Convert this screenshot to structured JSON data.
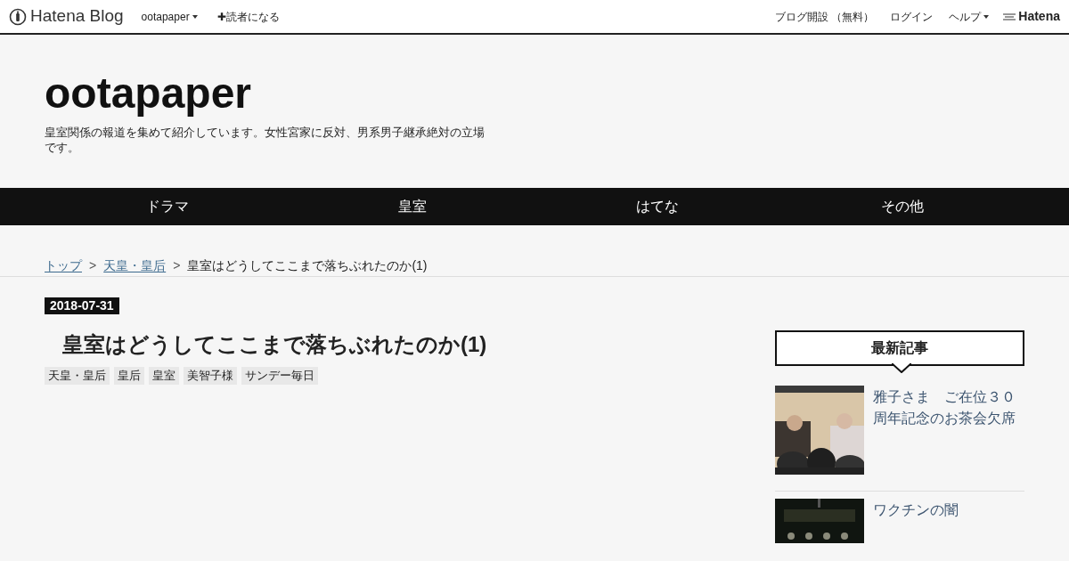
{
  "topbar": {
    "logo": "Hatena Blog",
    "blog_menu": "ootapaper",
    "subscribe": "✚読者になる",
    "links": [
      "ブログ開設 （無料）",
      "ログイン"
    ],
    "help_menu": "ヘルプ",
    "brand": "Hatena"
  },
  "blog": {
    "title": "ootapaper",
    "description": "皇室関係の報道を集めて紹介しています。女性宮家に反対、男系男子継承絶対の立場です。"
  },
  "nav": [
    "ドラマ",
    "皇室",
    "はてな",
    "その他"
  ],
  "breadcrumb_separators": [
    ">",
    ">"
  ],
  "breadcrumb": [
    {
      "label": "トップ",
      "link": true
    },
    {
      "label": "天皇・皇后",
      "link": true
    },
    {
      "label": "皇室はどうしてここまで落ちぶれたのか(1)",
      "link": false
    }
  ],
  "article": {
    "date": "2018-07-31",
    "title": "皇室はどうしてここまで落ちぶれたのか(1)",
    "tags": [
      "天皇・皇后",
      "皇后",
      "皇室",
      "美智子様",
      "サンデー毎日"
    ]
  },
  "sidebar": {
    "heading": "最新記事",
    "entries": [
      {
        "title": "雅子さま　ご在位３０周年記念のお茶会欠席"
      },
      {
        "title": "ワクチンの闇"
      }
    ]
  }
}
